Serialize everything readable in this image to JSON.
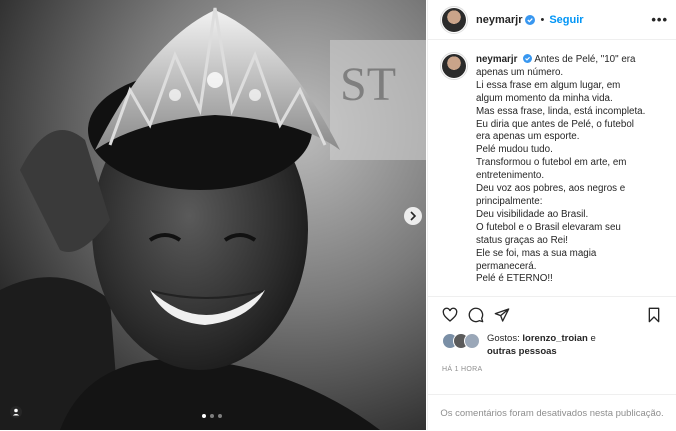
{
  "post": {
    "image_alt_icon": "photo-of-pele-with-crown",
    "carousel_dot_count": 3,
    "carousel_active_index": 0
  },
  "header": {
    "username": "neymarjr",
    "separator": "•",
    "follow_label": "Seguir",
    "more_label": "•••"
  },
  "caption": {
    "username": "neymarjr",
    "lines": [
      "Antes de Pelé, \"10\" era",
      "apenas um número.",
      "Li essa frase em algum lugar, em",
      "algum momento da minha vida.",
      "Mas essa frase, linda, está incompleta.",
      "Eu diria que antes de Pelé, o futebol",
      "era apenas um esporte.",
      "Pelé mudou tudo.",
      "Transformou o futebol em arte, em",
      "entretenimento.",
      "Deu voz aos pobres, aos negros e",
      "principalmente:",
      "Deu visibilidade ao Brasil.",
      "O futebol e o Brasil elevaram seu",
      "status graças ao Rei!",
      "Ele se foi, mas a sua magia",
      "permanecerá.",
      "Pelé é ETERNO!!"
    ]
  },
  "likes": {
    "prefix": "Gostos:",
    "first_liker": "lorenzo_troian",
    "suffix": "e",
    "others": "outras pessoas"
  },
  "timestamp": "HÁ 1 HORA",
  "comments_disabled": "Os comentários foram desativados nesta publicação.",
  "colors": {
    "accent": "#0095f6",
    "text": "#262626",
    "muted": "#8e8e8e",
    "verified": "#3897f0"
  }
}
